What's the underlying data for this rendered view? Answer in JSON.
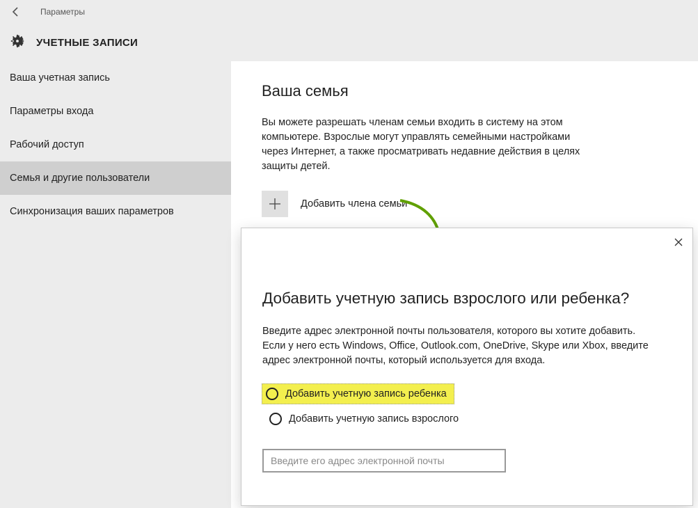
{
  "topbar": {
    "title": "Параметры"
  },
  "header": {
    "title": "УЧЕТНЫЕ ЗАПИСИ"
  },
  "sidebar": {
    "items": [
      {
        "label": "Ваша учетная запись",
        "selected": false
      },
      {
        "label": "Параметры входа",
        "selected": false
      },
      {
        "label": "Рабочий доступ",
        "selected": false
      },
      {
        "label": "Семья и другие пользователи",
        "selected": true
      },
      {
        "label": "Синхронизация ваших параметров",
        "selected": false
      }
    ]
  },
  "main": {
    "section_title": "Ваша семья",
    "section_desc": "Вы можете разрешать членам семьи входить в систему на этом компьютере. Взрослые могут управлять семейными настройками через Интернет, а также просматривать недавние действия в целях защиты детей.",
    "add_label": "Добавить члена семьи"
  },
  "dialog": {
    "title": "Добавить учетную запись взрослого или ребенка?",
    "desc": "Введите адрес электронной почты пользователя, которого вы хотите добавить. Если у него есть Windows, Office, Outlook.com, OneDrive, Skype или Xbox, введите адрес электронной почты, который используется для входа.",
    "radio1": "Добавить учетную запись ребенка",
    "radio2": "Добавить учетную запись взрослого",
    "email_placeholder": "Введите его адрес электронной почты"
  }
}
